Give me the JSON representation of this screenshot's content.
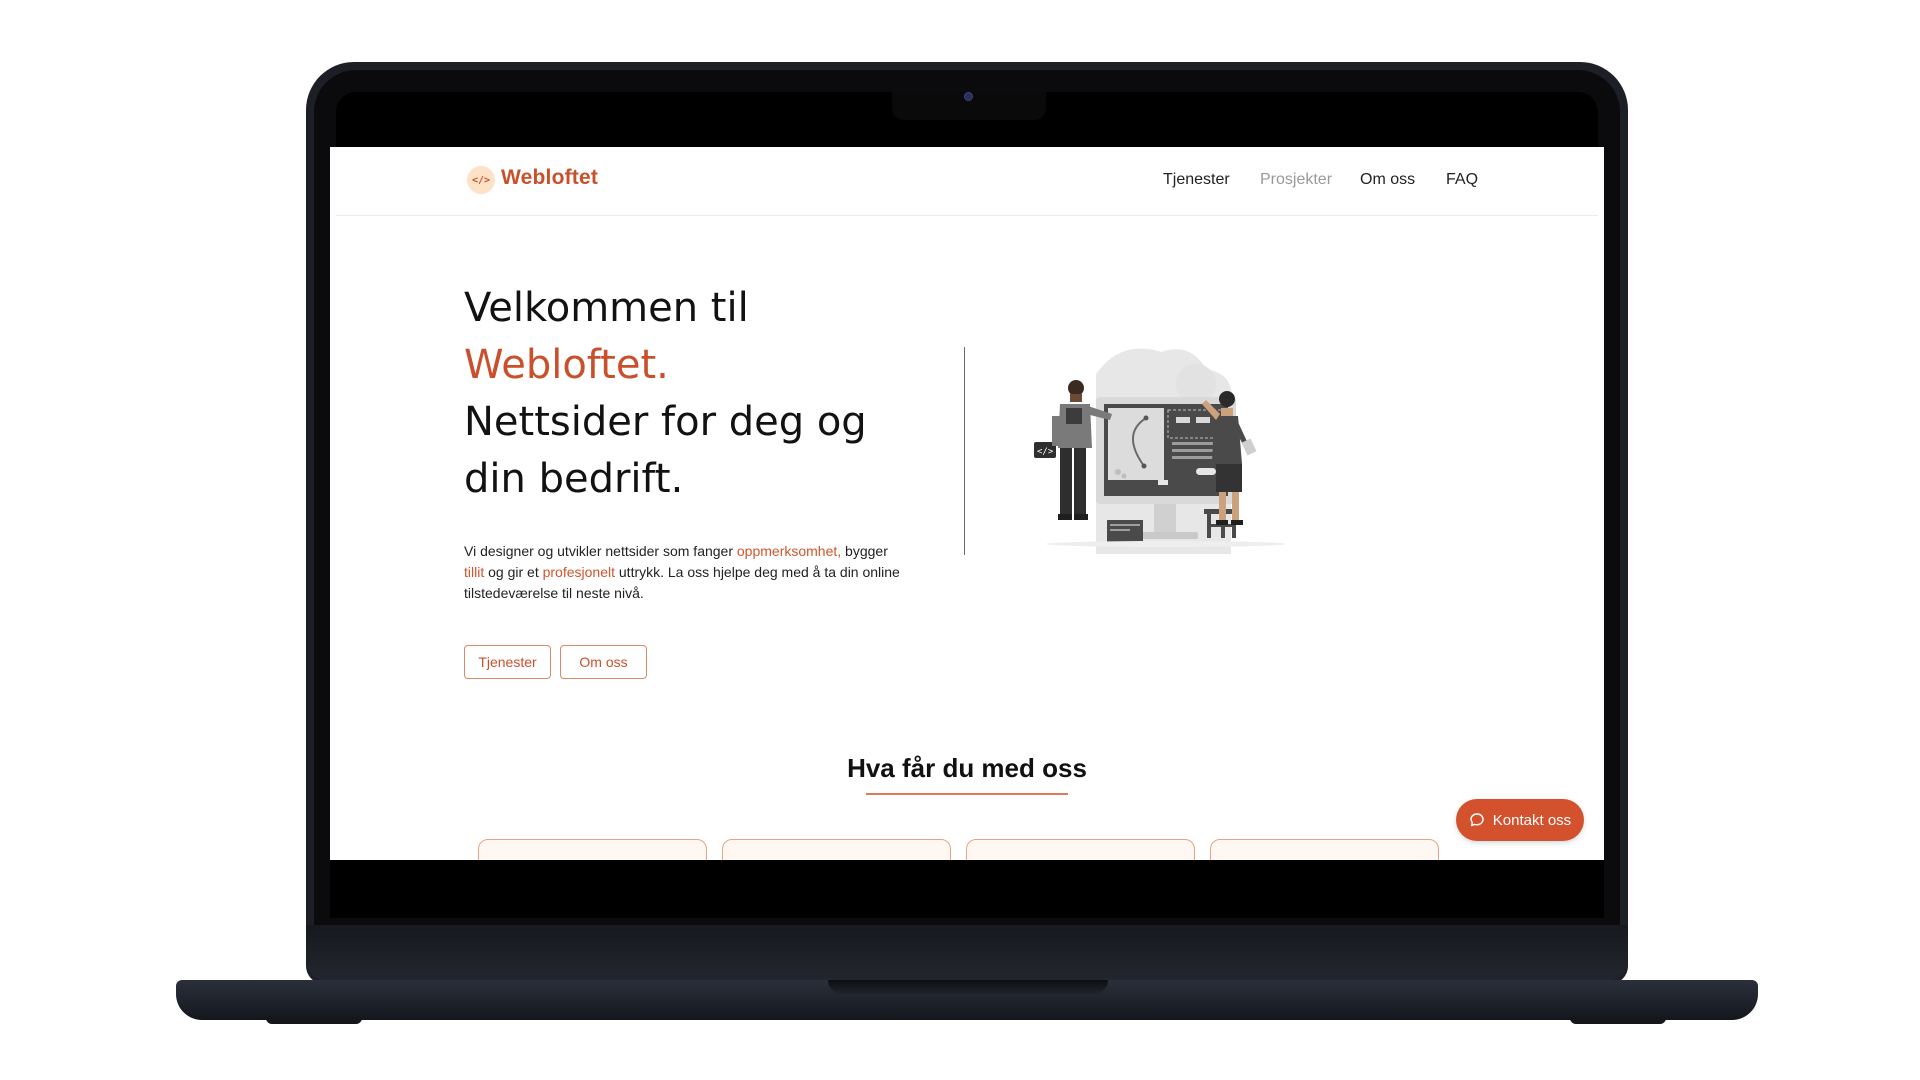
{
  "brand": {
    "name": "Webloftet",
    "badge_glyph": "</>"
  },
  "nav": {
    "items": [
      {
        "label": "Tjenester",
        "state": "default"
      },
      {
        "label": "Prosjekter",
        "state": "muted"
      },
      {
        "label": "Om oss",
        "state": "default"
      },
      {
        "label": "FAQ",
        "state": "default"
      }
    ]
  },
  "hero": {
    "line1": "Velkommen til",
    "line2": "Webloftet.",
    "line3": "Nettsider for deg og din bedrift.",
    "text_a": "Vi designer og utvikler nettsider som fanger ",
    "hl1": "oppmerksomhet,",
    "text_b": " bygger ",
    "hl2": "tillit",
    "text_c": " og gir et ",
    "hl3": "profesjonelt",
    "text_d": " uttrykk. La oss hjelpe deg med å ta din online tilstedeværelse til neste nivå.",
    "buttons": [
      {
        "label": "Tjenester"
      },
      {
        "label": "Om oss"
      }
    ]
  },
  "section": {
    "title": "Hva får du med oss"
  },
  "cta": {
    "label": "Kontakt oss",
    "icon": "chat-bubble-icon"
  },
  "colors": {
    "accent": "#c9502b",
    "cta_bg": "#d4512d",
    "card_bg": "#fff8f2",
    "card_border": "#e7a387"
  }
}
